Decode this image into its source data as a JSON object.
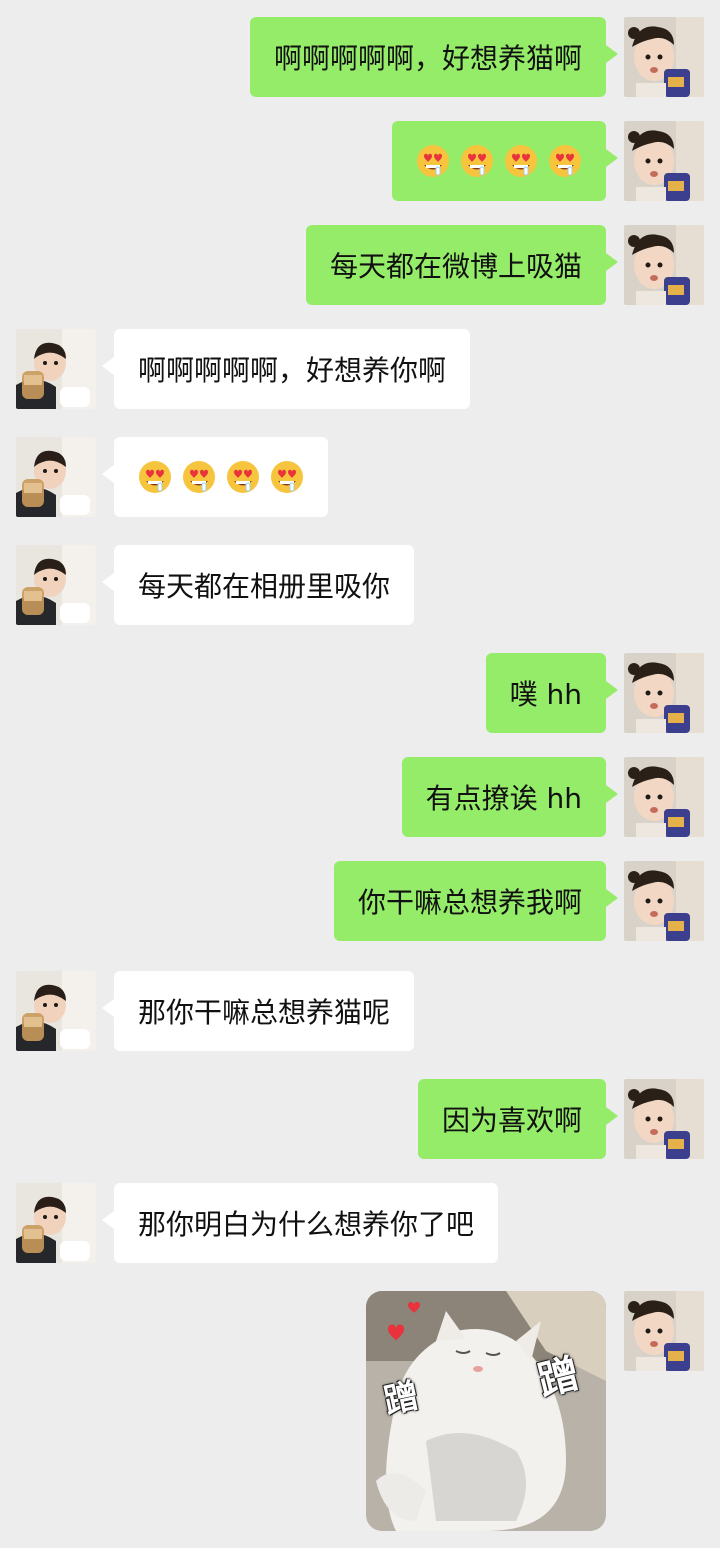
{
  "chat": {
    "messages": [
      {
        "side": "right",
        "text": "啊啊啊啊啊，好想养猫啊"
      },
      {
        "side": "right",
        "emoji": [
          "heart-eyes-drool-emoji",
          "heart-eyes-drool-emoji",
          "heart-eyes-drool-emoji",
          "heart-eyes-drool-emoji"
        ]
      },
      {
        "side": "right",
        "text": "每天都在微博上吸猫"
      },
      {
        "side": "left",
        "text": "啊啊啊啊啊，好想养你啊"
      },
      {
        "side": "left",
        "emoji": [
          "heart-eyes-drool-emoji",
          "heart-eyes-drool-emoji",
          "heart-eyes-drool-emoji",
          "heart-eyes-drool-emoji"
        ]
      },
      {
        "side": "left",
        "text": "每天都在相册里吸你"
      },
      {
        "side": "right",
        "text": "噗 hh"
      },
      {
        "side": "right",
        "text": "有点撩诶 hh"
      },
      {
        "side": "right",
        "text": "你干嘛总想养我啊"
      },
      {
        "side": "left",
        "text": "那你干嘛总想养猫呢"
      },
      {
        "side": "right",
        "text": "因为喜欢啊"
      },
      {
        "side": "left",
        "text": "那你明白为什么想养你了吧"
      },
      {
        "side": "right",
        "sticker": {
          "label_left": "蹭",
          "label_right": "蹭"
        }
      }
    ]
  },
  "colors": {
    "background": "#ededed",
    "outgoing_bubble": "#95ec69",
    "incoming_bubble": "#ffffff"
  }
}
